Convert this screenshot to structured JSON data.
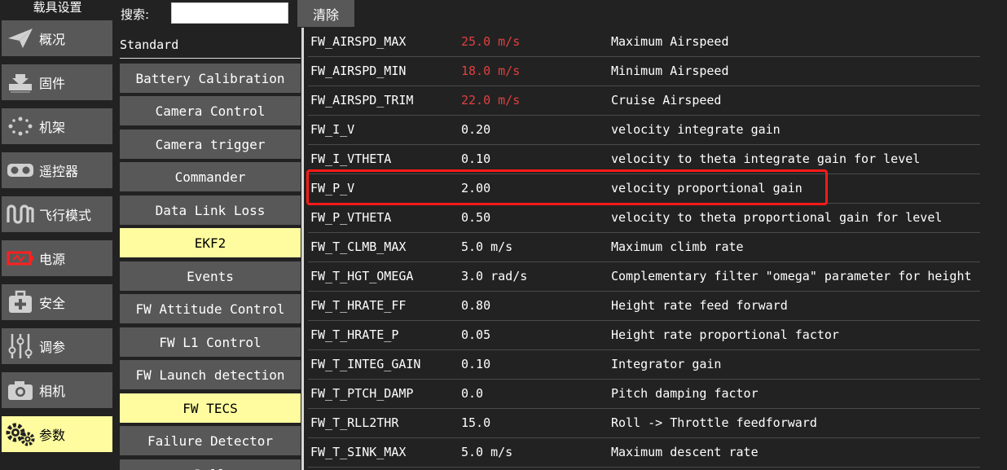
{
  "sidebar": {
    "title": "载具设置",
    "items": [
      {
        "label": "概况",
        "icon": "paper-plane-icon",
        "active": false
      },
      {
        "label": "固件",
        "icon": "download-icon",
        "active": false
      },
      {
        "label": "机架",
        "icon": "airframe-icon",
        "active": false
      },
      {
        "label": "遥控器",
        "icon": "radio-icon",
        "active": false
      },
      {
        "label": "飞行模式",
        "icon": "flight-modes-icon",
        "active": false
      },
      {
        "label": "电源",
        "icon": "battery-icon",
        "active": false
      },
      {
        "label": "安全",
        "icon": "safety-icon",
        "active": false
      },
      {
        "label": "调参",
        "icon": "tuning-sliders-icon",
        "active": false
      },
      {
        "label": "相机",
        "icon": "camera-icon",
        "active": false
      },
      {
        "label": "参数",
        "icon": "gears-icon",
        "active": true
      }
    ]
  },
  "search": {
    "label": "搜索:",
    "value": "",
    "clear_label": "清除"
  },
  "groups": {
    "header": "Standard",
    "items": [
      {
        "label": "Battery Calibration",
        "active": false
      },
      {
        "label": "Camera Control",
        "active": false
      },
      {
        "label": "Camera trigger",
        "active": false
      },
      {
        "label": "Commander",
        "active": false
      },
      {
        "label": "Data Link Loss",
        "active": false
      },
      {
        "label": "EKF2",
        "active": true
      },
      {
        "label": "Events",
        "active": false
      },
      {
        "label": "FW Attitude Control",
        "active": false
      },
      {
        "label": "FW L1 Control",
        "active": false
      },
      {
        "label": "FW Launch detection",
        "active": false
      },
      {
        "label": "FW TECS",
        "active": true
      },
      {
        "label": "Failure Detector",
        "active": false
      },
      {
        "label": "Roll",
        "active": false
      }
    ]
  },
  "params": [
    {
      "name": "FW_AIRSPD_MAX",
      "value": "25.0 m/s",
      "desc": "Maximum Airspeed",
      "modified": true
    },
    {
      "name": "FW_AIRSPD_MIN",
      "value": "18.0 m/s",
      "desc": "Minimum Airspeed",
      "modified": true
    },
    {
      "name": "FW_AIRSPD_TRIM",
      "value": "22.0 m/s",
      "desc": "Cruise Airspeed",
      "modified": true
    },
    {
      "name": "FW_I_V",
      "value": "0.20",
      "desc": "velocity integrate gain",
      "modified": false
    },
    {
      "name": "FW_I_VTHETA",
      "value": "0.10",
      "desc": "velocity to theta integrate gain for level",
      "modified": false
    },
    {
      "name": "FW_P_V",
      "value": "2.00",
      "desc": "velocity proportional gain",
      "modified": false
    },
    {
      "name": "FW_P_VTHETA",
      "value": "0.50",
      "desc": "velocity to theta proportional gain for level",
      "modified": false
    },
    {
      "name": "FW_T_CLMB_MAX",
      "value": "5.0 m/s",
      "desc": "Maximum climb rate",
      "modified": false
    },
    {
      "name": "FW_T_HGT_OMEGA",
      "value": "3.0 rad/s",
      "desc": "Complementary filter \"omega\" parameter for height",
      "modified": false
    },
    {
      "name": "FW_T_HRATE_FF",
      "value": "0.80",
      "desc": "Height rate feed forward",
      "modified": false
    },
    {
      "name": "FW_T_HRATE_P",
      "value": "0.05",
      "desc": "Height rate proportional factor",
      "modified": false
    },
    {
      "name": "FW_T_INTEG_GAIN",
      "value": "0.10",
      "desc": "Integrator gain",
      "modified": false
    },
    {
      "name": "FW_T_PTCH_DAMP",
      "value": "0.0",
      "desc": "Pitch damping factor",
      "modified": false
    },
    {
      "name": "FW_T_RLL2THR",
      "value": "15.0",
      "desc": "Roll -> Throttle feedforward",
      "modified": false
    },
    {
      "name": "FW_T_SINK_MAX",
      "value": "5.0 m/s",
      "desc": "Maximum descent rate",
      "modified": false
    }
  ],
  "highlight_row": "FW_P_V",
  "colors": {
    "background": "#222222",
    "button": "#585858",
    "active": "#fffca0",
    "modified_value": "#e04040",
    "highlight_box": "#ff1a1a"
  }
}
